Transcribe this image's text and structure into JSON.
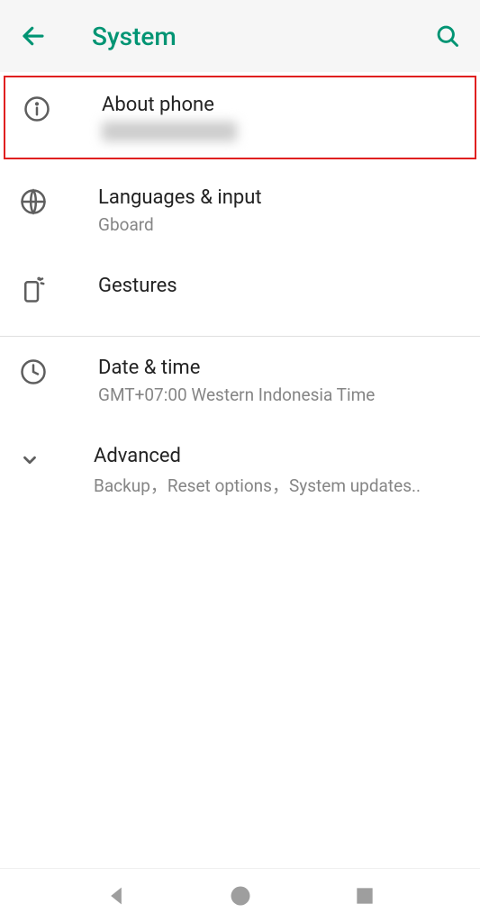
{
  "header": {
    "title": "System"
  },
  "items": [
    {
      "title": "About phone",
      "subtitle": ""
    },
    {
      "title": "Languages & input",
      "subtitle": "Gboard"
    },
    {
      "title": "Gestures",
      "subtitle": ""
    },
    {
      "title": "Date & time",
      "subtitle": "GMT+07:00 Western Indonesia Time"
    },
    {
      "title": "Advanced",
      "subtitle": "Backup，Reset options，System updates.."
    }
  ]
}
